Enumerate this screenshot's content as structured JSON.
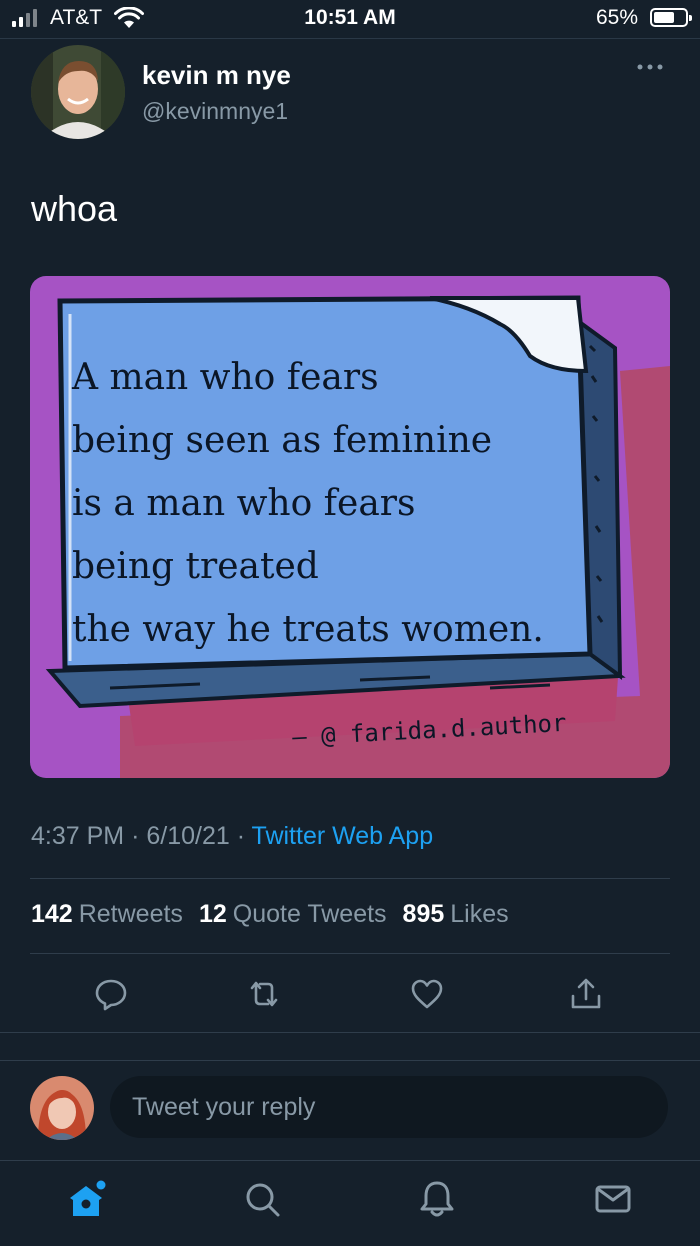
{
  "status_bar": {
    "carrier": "AT&T",
    "time": "10:51 AM",
    "battery": "65%",
    "battery_level": 0.65
  },
  "tweet": {
    "author_name": "kevin m nye",
    "author_handle": "@kevinmnye1",
    "text": "whoa",
    "image": {
      "quote_lines": [
        "A man who fears",
        "being seen as feminine",
        "is a man who fears",
        "being treated",
        "the way he treats women."
      ],
      "credit": "— @ farida.d.author"
    },
    "time": "4:37 PM",
    "date": "6/10/21",
    "source": "Twitter Web App",
    "stats": {
      "retweets_count": "142",
      "retweets_label": "Retweets",
      "quotes_count": "12",
      "quotes_label": "Quote Tweets",
      "likes_count": "895",
      "likes_label": "Likes"
    }
  },
  "reply": {
    "placeholder": "Tweet your reply"
  },
  "icons": {
    "reply": "comment-icon",
    "retweet": "retweet-icon",
    "like": "heart-icon",
    "share": "share-icon",
    "home": "home-icon",
    "search": "search-icon",
    "notifications": "bell-icon",
    "messages": "mail-icon"
  },
  "colors": {
    "background": "#15202b",
    "accent": "#1da1f2",
    "secondary_text": "#8899a6"
  }
}
